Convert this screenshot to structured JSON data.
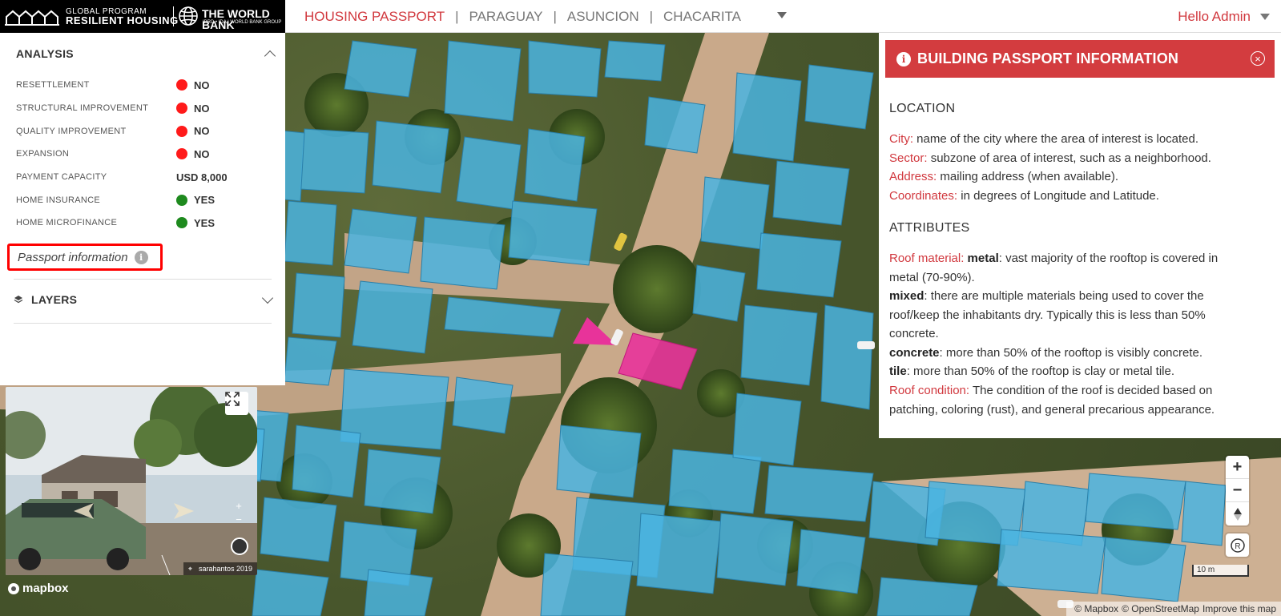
{
  "header": {
    "logo": {
      "program": "GLOBAL PROGRAM",
      "name": "RESILIENT HOUSING",
      "bank": "THE WORLD BANK",
      "bank_sub": "IBRD • IDA | WORLD BANK GROUP"
    },
    "breadcrumb": [
      "HOUSING PASSPORT",
      "PARAGUAY",
      "ASUNCION",
      "CHACARITA"
    ],
    "user_greeting": "Hello Admin"
  },
  "analysis": {
    "title": "ANALYSIS",
    "rows": [
      {
        "label": "RESETTLEMENT",
        "value": "NO",
        "status": "red"
      },
      {
        "label": "STRUCTURAL IMPROVEMENT",
        "value": "NO",
        "status": "red"
      },
      {
        "label": "QUALITY IMPROVEMENT",
        "value": "NO",
        "status": "red"
      },
      {
        "label": "EXPANSION",
        "value": "NO",
        "status": "red"
      },
      {
        "label": "PAYMENT CAPACITY",
        "value": "USD 8,000",
        "status": ""
      },
      {
        "label": "HOME INSURANCE",
        "value": "YES",
        "status": "green"
      },
      {
        "label": "HOME MICROFINANCE",
        "value": "YES",
        "status": "green"
      }
    ],
    "passport_link": "Passport information",
    "info_glyph": "i"
  },
  "layers": {
    "title": "LAYERS"
  },
  "street_view": {
    "credit": "sarahantos 2019",
    "zoom_in": "+",
    "zoom_out": "−"
  },
  "mapbox_logo": "mapbox",
  "info_panel": {
    "title": "BUILDING PASSPORT INFORMATION",
    "info_glyph": "i",
    "close_glyph": "×",
    "location_heading": "LOCATION",
    "city_label": "City:",
    "city_text": " name of the city where the area of interest is located.",
    "sector_label": "Sector:",
    "sector_text": " subzone of area of interest, such as a neighborhood.",
    "address_label": "Address:",
    "address_text": " mailing address (when available).",
    "coords_label": "Coordinates:",
    "coords_text": " in degrees of Longitude and Latitude.",
    "attributes_heading": "ATTRIBUTES",
    "roof_material_label": "Roof material:",
    "metal_term": "metal",
    "metal_text": ": vast majority of the rooftop is covered in metal (70-90%).",
    "mixed_term": "mixed",
    "mixed_text": ": there are multiple materials being used to cover the roof/keep the inhabitants dry. Typically this is less than 50% concrete.",
    "concrete_term": "concrete",
    "concrete_text": ": more than 50% of the rooftop is visibly concrete.",
    "tile_term": "tile",
    "tile_text": ": more than 50% of the rooftop is clay or metal tile.",
    "roof_condition_label": "Roof condition:",
    "roof_condition_text": " The condition of the roof is decided based on patching, coloring (rust), and general precarious appearance."
  },
  "map_controls": {
    "zoom_in": "+",
    "zoom_out": "−",
    "rotate": "R",
    "scale": "10 m"
  },
  "attribution": {
    "mapbox": "© Mapbox",
    "osm": "© OpenStreetMap",
    "improve": "Improve this map"
  },
  "colors": {
    "accent": "#d1383e",
    "status_red": "#ff1a1a",
    "status_green": "#1e8a1e",
    "building": "#4ab4e0",
    "highlight": "#e8339a"
  }
}
